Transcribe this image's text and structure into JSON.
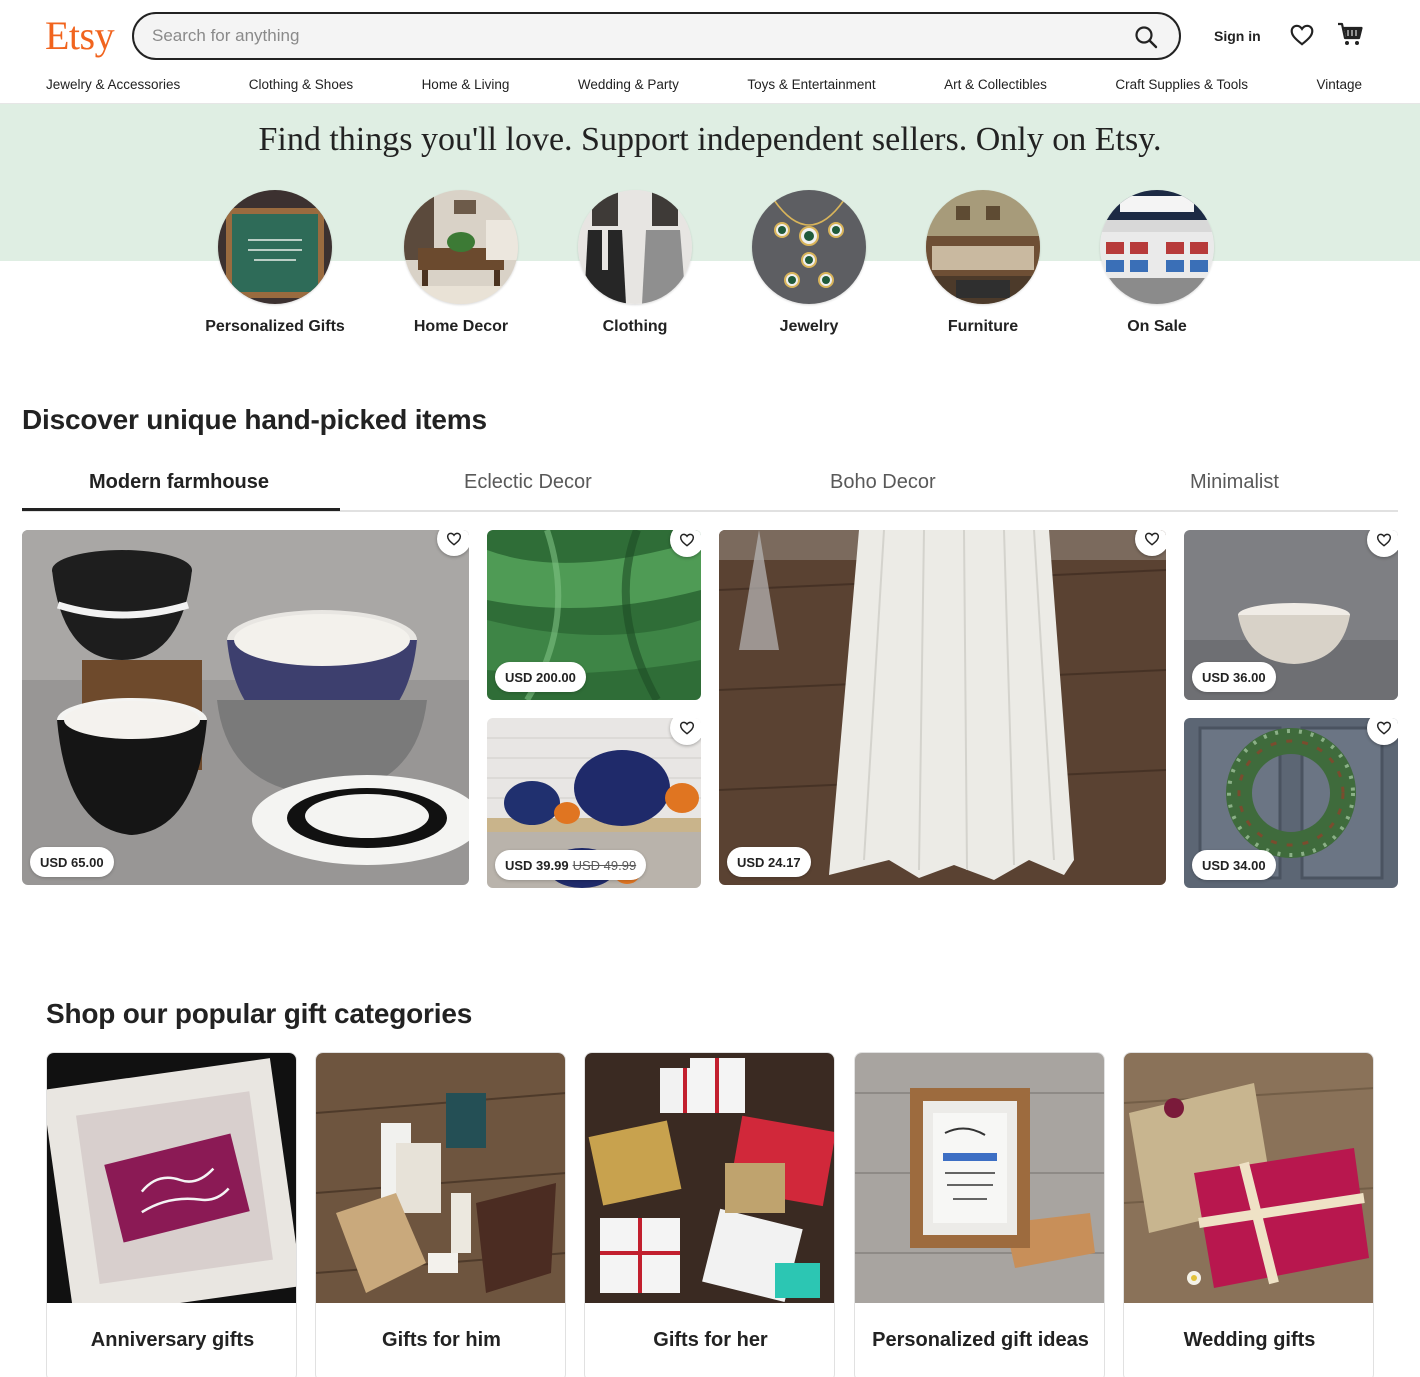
{
  "header": {
    "logo": "Etsy",
    "search_placeholder": "Search for anything",
    "sign_in": "Sign in"
  },
  "nav": {
    "categories": [
      "Jewelry & Accessories",
      "Clothing & Shoes",
      "Home & Living",
      "Wedding & Party",
      "Toys & Entertainment",
      "Art & Collectibles",
      "Craft Supplies & Tools",
      "Vintage"
    ]
  },
  "hero": {
    "title": "Find things you'll love. Support independent sellers. Only on Etsy.",
    "circles": [
      {
        "label": "Personalized Gifts"
      },
      {
        "label": "Home Decor"
      },
      {
        "label": "Clothing"
      },
      {
        "label": "Jewelry"
      },
      {
        "label": "Furniture"
      },
      {
        "label": "On Sale"
      }
    ]
  },
  "discover": {
    "title": "Discover unique hand-picked items",
    "tabs": [
      "Modern farmhouse",
      "Eclectic Decor",
      "Boho Decor",
      "Minimalist"
    ],
    "active_tab": "Modern farmhouse",
    "items": [
      {
        "price": "USD 65.00",
        "image": "ceramic bowls"
      },
      {
        "price": "USD 200.00",
        "image": "green velvet fabric"
      },
      {
        "price": "USD 39.99",
        "original_price": "USD 49.99",
        "image": "velvet pumpkins"
      },
      {
        "price": "USD 24.17",
        "image": "linen table runner"
      },
      {
        "price": "USD 36.00",
        "image": "stoneware bowl"
      },
      {
        "price": "USD 34.00",
        "image": "pine wreath"
      }
    ]
  },
  "gifts": {
    "title": "Shop our popular gift categories",
    "categories": [
      {
        "label": "Anniversary gifts"
      },
      {
        "label": "Gifts for him"
      },
      {
        "label": "Gifts for her"
      },
      {
        "label": "Personalized gift ideas"
      },
      {
        "label": "Wedding gifts"
      }
    ]
  },
  "colors": {
    "brand": "#f1641e",
    "hero_band": "#dfeee3",
    "text": "#222222"
  },
  "icons": [
    "search-icon",
    "heart-icon",
    "cart-icon"
  ]
}
